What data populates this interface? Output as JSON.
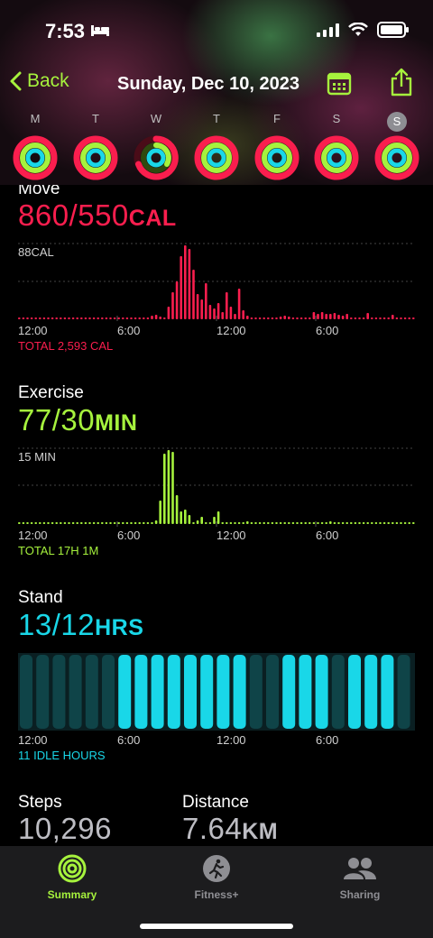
{
  "status_bar": {
    "time": "7:53"
  },
  "header": {
    "back_label": "Back",
    "title": "Sunday, Dec 10, 2023"
  },
  "week": {
    "days": [
      "M",
      "T",
      "W",
      "T",
      "F",
      "S",
      "S"
    ],
    "current_index": 6
  },
  "move": {
    "label": "Move",
    "value": "860/550",
    "unit": "CAL",
    "max_label": "88CAL",
    "total": "TOTAL 2,593 CAL",
    "color": "#fa1e4e"
  },
  "exercise": {
    "label": "Exercise",
    "value": "77/30",
    "unit": "MIN",
    "max_label": "15 MIN",
    "total": "TOTAL 17H 1M",
    "color": "#a6f23d"
  },
  "stand": {
    "label": "Stand",
    "value": "13/12",
    "unit": "HRS",
    "total": "11 IDLE HOURS",
    "color": "#19d7e8"
  },
  "time_axis": [
    "12:00",
    "6:00",
    "12:00",
    "6:00"
  ],
  "steps": {
    "label": "Steps",
    "value": "10,296"
  },
  "distance": {
    "label": "Distance",
    "value": "7.64",
    "unit": "KM"
  },
  "tabs": [
    {
      "label": "Summary",
      "icon": "activity-rings-icon",
      "active": true
    },
    {
      "label": "Fitness+",
      "icon": "runner-icon",
      "active": false
    },
    {
      "label": "Sharing",
      "icon": "people-icon",
      "active": false
    }
  ]
}
